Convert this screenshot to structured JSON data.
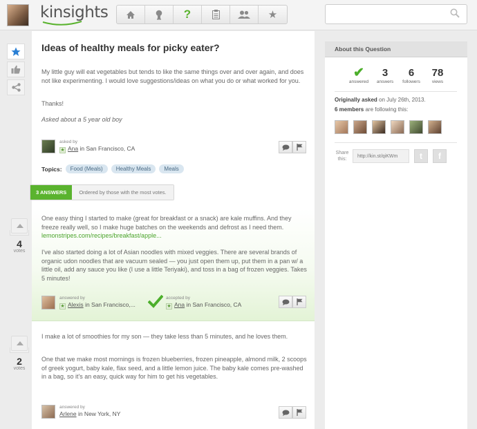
{
  "header": {
    "logo": "kinsights",
    "nav": [
      {
        "name": "home-icon",
        "glyph": "⌂"
      },
      {
        "name": "bulb-icon",
        "glyph": "♙"
      },
      {
        "name": "question-icon",
        "glyph": "?"
      },
      {
        "name": "clipboard-icon",
        "glyph": "▤"
      },
      {
        "name": "people-icon",
        "glyph": "⚇"
      },
      {
        "name": "star-icon",
        "glyph": "★"
      }
    ],
    "search_placeholder": ""
  },
  "question": {
    "title": "Ideas of healthy meals for picky eater?",
    "body": "My little guy will eat vegetables but tends to like the same things over and over again, and does not like experimenting. I would love suggestions/ideas on what you do or what worked for you.",
    "thanks": "Thanks!",
    "context": "Asked about a 5 year old boy",
    "asked_by_label": "asked by",
    "author": "Ana",
    "location": "in San Francisco, CA",
    "topics_label": "Topics:",
    "topics": [
      "Food (Meals)",
      "Healthy Meals",
      "Meals"
    ]
  },
  "answers_bar": {
    "count_label": "3 ANSWERS",
    "order_label": "Ordered by those with the most votes."
  },
  "answers": [
    {
      "voted_label": "voted",
      "votes": "4",
      "votes_label": "votes",
      "p1": "One easy thing I started to make (great for breakfast or a snack) are kale muffins. And they freeze really well, so I make huge batches on the weekends and defrost as I need them.",
      "link": "lemonstripes.com/recipes/breakfast/apple...",
      "p2": "I've also started doing a lot of Asian noodles with mixed veggies. There are several brands of organic udon noodles that are vacuum sealed — you just open them up, put them in a pan w/ a little oil, add any sauce you like (I use a little Teriyaki), and toss in a bag of frozen veggies. Takes 5 minutes!",
      "answered_by_label": "answered by",
      "author": "Alexis",
      "location": "in San Francisco,...",
      "accepted_by_label": "accepted by",
      "accepted_author": "Ana",
      "accepted_location": "in San Francisco, CA"
    },
    {
      "voted_label": "voted",
      "votes": "2",
      "votes_label": "votes",
      "p1": "I make a lot of smoothies for my son — they take less than 5 minutes, and he loves them.",
      "p2": "One that we make most mornings is frozen blueberries, frozen pineapple, almond milk, 2 scoops of greek yogurt, baby kale, flax seed, and a little lemon juice. The baby kale comes pre-washed in a bag, so it's an easy, quick way for him to get his vegetables.",
      "answered_by_label": "answered by",
      "author": "Arlene",
      "location": "in New York, NY"
    }
  ],
  "sidebar": {
    "title": "About this Question",
    "stats": [
      {
        "value": "✔",
        "label": "answered"
      },
      {
        "value": "3",
        "label": "answers"
      },
      {
        "value": "6",
        "label": "followers"
      },
      {
        "value": "78",
        "label": "views"
      }
    ],
    "asked_prefix": "Originally asked",
    "asked_suffix": "on July 26th, 2013.",
    "following_prefix": "6 members",
    "following_suffix": "are following this:",
    "share_label": "Share this:",
    "share_url": "http://kin.st/qiKWm",
    "twitter": "t",
    "facebook": "f"
  },
  "colors": {
    "accent_green": "#5ab32e",
    "tag_bg": "#d9e6f0",
    "star_blue": "#2a7fd4"
  }
}
